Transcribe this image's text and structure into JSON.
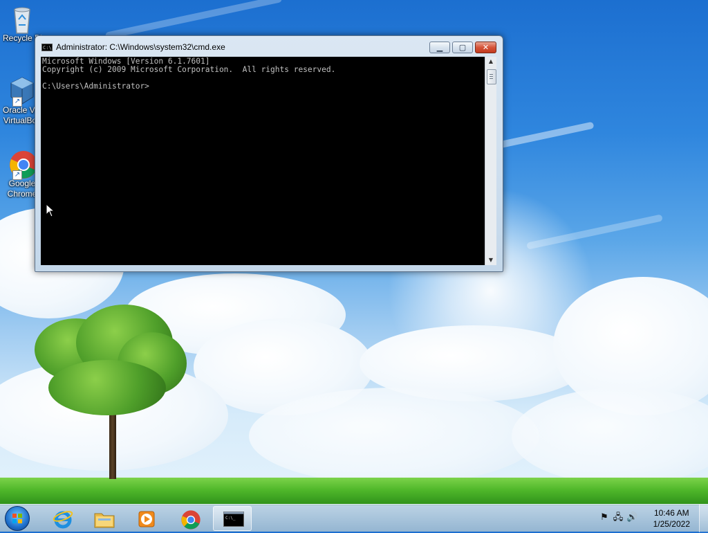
{
  "desktop": {
    "icons": [
      {
        "name": "recycle-bin",
        "label": "Recycle Bin"
      },
      {
        "name": "oracle-virtualbox",
        "label_line1": "Oracle VM",
        "label_line2": "VirtualBox"
      },
      {
        "name": "google-chrome",
        "label_line1": "Google",
        "label_line2": "Chrome"
      }
    ]
  },
  "window": {
    "title": "Administrator: C:\\Windows\\system32\\cmd.exe",
    "title_icon_text": "C:\\",
    "buttons": {
      "minimize": "▁",
      "maximize": "▢",
      "close": "✕"
    },
    "console_lines": [
      "Microsoft Windows [Version 6.1.7601]",
      "Copyright (c) 2009 Microsoft Corporation.  All rights reserved.",
      "",
      "C:\\Users\\Administrator>"
    ]
  },
  "taskbar": {
    "pinned": [
      {
        "name": "internet-explorer",
        "icon": "internet-explorer-icon"
      },
      {
        "name": "windows-explorer",
        "icon": "folder-icon"
      },
      {
        "name": "windows-media-player",
        "icon": "media-player-icon"
      },
      {
        "name": "google-chrome",
        "icon": "chrome-icon"
      },
      {
        "name": "command-prompt",
        "icon": "cmd-icon",
        "active": true
      }
    ],
    "tray": {
      "time": "10:46 AM",
      "date": "1/25/2022",
      "icons": [
        "flag-icon",
        "network-icon",
        "volume-icon"
      ]
    }
  },
  "colors": {
    "console_bg": "#000000",
    "console_fg": "#c0c0c0",
    "close_red": "#c13a1e",
    "taskbar": "#8cafcd"
  }
}
